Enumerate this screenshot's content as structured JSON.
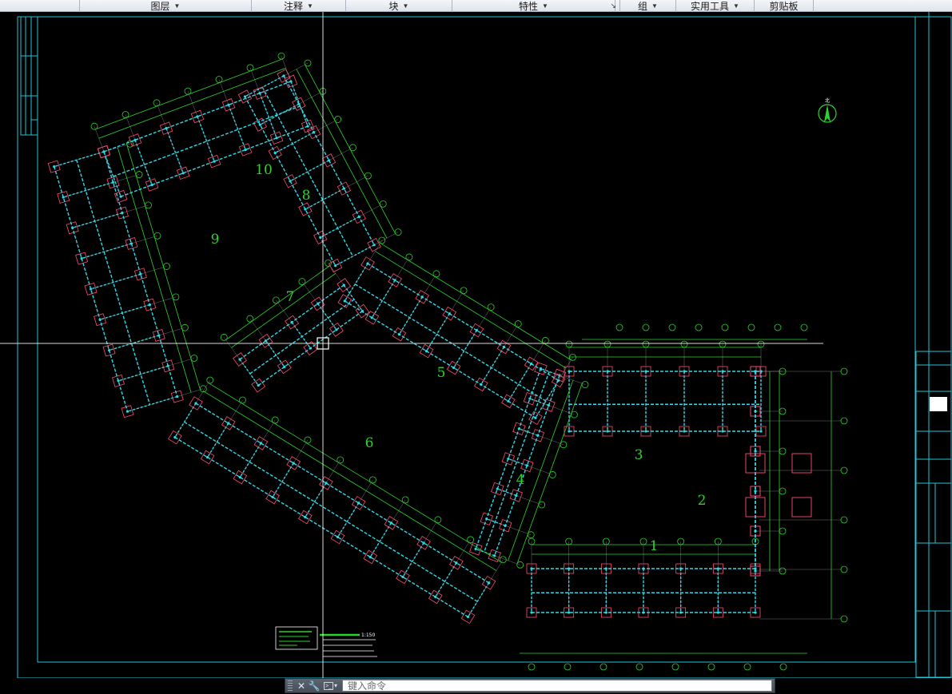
{
  "ribbon": {
    "panels": [
      {
        "label": "图层",
        "dropdown": "▼"
      },
      {
        "label": "注释",
        "dropdown": "▼"
      },
      {
        "label": "块",
        "dropdown": "▼"
      },
      {
        "label": "特性",
        "dropdown": "▼"
      },
      {
        "label": "",
        "dropdown": "↘"
      },
      {
        "label": "组",
        "dropdown": "▼"
      },
      {
        "label": "实用工具",
        "dropdown": "▼"
      },
      {
        "label": "剪贴板",
        "dropdown": ""
      }
    ]
  },
  "drawing": {
    "zone_labels": [
      "1",
      "2",
      "3",
      "4",
      "5",
      "6",
      "7",
      "8",
      "9",
      "10"
    ],
    "north_label": "北",
    "scale_note": "1:150",
    "line_colors": {
      "column_grid": "#32d7e6",
      "dimension": "#2dd32d",
      "footing": "#ff4d78",
      "axis_bubble": "#2dd32d",
      "frame": "#1fc6d8",
      "crosshair": "#ffffff"
    }
  },
  "command_line": {
    "close_icon": "✕",
    "settings_icon": "🔧",
    "prompt_icon": ">_",
    "placeholder": "键入命令"
  }
}
